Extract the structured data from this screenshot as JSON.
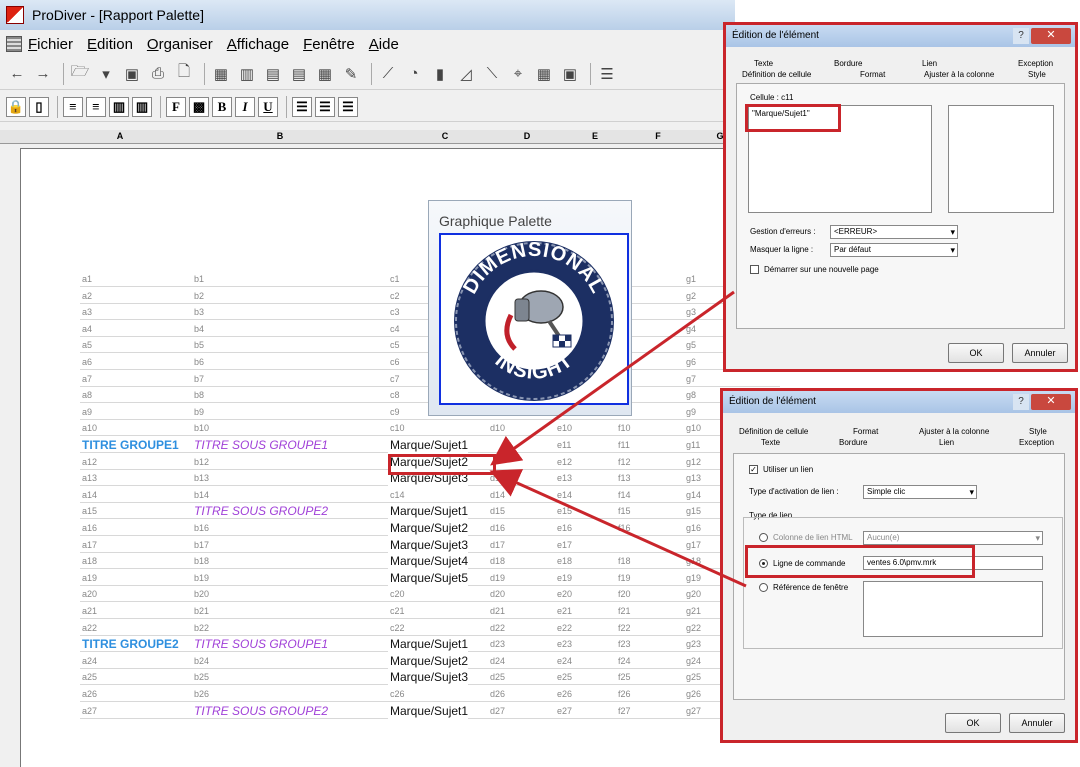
{
  "window": {
    "title": "ProDiver - [Rapport Palette]"
  },
  "menu": [
    "Fichier",
    "Edition",
    "Organiser",
    "Affichage",
    "Fenêtre",
    "Aide"
  ],
  "columns": [
    "A",
    "B",
    "C",
    "D",
    "E",
    "F",
    "G"
  ],
  "palette": {
    "title": "Graphique Palette",
    "logo_top": "DIMENSIONAL",
    "logo_bottom": "INSIGHT"
  },
  "rows": [
    [
      "a1",
      "b1",
      "c1",
      "",
      "",
      "",
      "g1"
    ],
    [
      "a2",
      "b2",
      "c2",
      "",
      "",
      "",
      "g2"
    ],
    [
      "a3",
      "b3",
      "c3",
      "",
      "",
      "",
      "g3"
    ],
    [
      "a4",
      "b4",
      "c4",
      "",
      "",
      "",
      "g4"
    ],
    [
      "a5",
      "b5",
      "c5",
      "",
      "",
      "",
      "g5"
    ],
    [
      "a6",
      "b6",
      "c6",
      "",
      "",
      "",
      "g6"
    ],
    [
      "a7",
      "b7",
      "c7",
      "",
      "",
      "",
      "g7"
    ],
    [
      "a8",
      "b8",
      "c8",
      "",
      "",
      "",
      "g8"
    ],
    [
      "a9",
      "b9",
      "c9",
      "d9",
      "e9",
      "f9",
      "g9"
    ],
    [
      "a10",
      "b10",
      "c10",
      "d10",
      "e10",
      "f10",
      "g10"
    ],
    [
      "TITRE GROUPE1",
      "TITRE SOUS GROUPE1",
      "Marque/Sujet1",
      "",
      "e11",
      "f11",
      "g11"
    ],
    [
      "a12",
      "b12",
      "Marque/Sujet2",
      "",
      "e12",
      "f12",
      "g12"
    ],
    [
      "a13",
      "b13",
      "Marque/Sujet3",
      "d13",
      "e13",
      "f13",
      "g13"
    ],
    [
      "a14",
      "b14",
      "c14",
      "d14",
      "e14",
      "f14",
      "g14"
    ],
    [
      "a15",
      "TITRE SOUS GROUPE2",
      "Marque/Sujet1",
      "d15",
      "e15",
      "f15",
      "g15"
    ],
    [
      "a16",
      "b16",
      "Marque/Sujet2",
      "d16",
      "e16",
      "f16",
      "g16"
    ],
    [
      "a17",
      "b17",
      "Marque/Sujet3",
      "d17",
      "e17",
      "",
      "g17"
    ],
    [
      "a18",
      "b18",
      "Marque/Sujet4",
      "d18",
      "e18",
      "f18",
      "g18"
    ],
    [
      "a19",
      "b19",
      "Marque/Sujet5",
      "d19",
      "e19",
      "f19",
      "g19"
    ],
    [
      "a20",
      "b20",
      "c20",
      "d20",
      "e20",
      "f20",
      "g20"
    ],
    [
      "a21",
      "b21",
      "c21",
      "d21",
      "e21",
      "f21",
      "g21"
    ],
    [
      "a22",
      "b22",
      "c22",
      "d22",
      "e22",
      "f22",
      "g22"
    ],
    [
      "TITRE GROUPE2",
      "TITRE SOUS GROUPE1",
      "Marque/Sujet1",
      "d23",
      "e23",
      "f23",
      "g23"
    ],
    [
      "a24",
      "b24",
      "Marque/Sujet2",
      "d24",
      "e24",
      "f24",
      "g24"
    ],
    [
      "a25",
      "b25",
      "Marque/Sujet3",
      "d25",
      "e25",
      "f25",
      "g25"
    ],
    [
      "a26",
      "b26",
      "c26",
      "d26",
      "e26",
      "f26",
      "g26"
    ],
    [
      "a27",
      "TITRE SOUS GROUPE2",
      "Marque/Sujet1",
      "d27",
      "e27",
      "f27",
      "g27"
    ]
  ],
  "dialog1": {
    "title": "Édition de l'élément",
    "tabs_row1": [
      "Texte",
      "Bordure",
      "Lien",
      "Exception"
    ],
    "tabs_row2": [
      "Définition de cellule",
      "Format",
      "Ajuster à la colonne",
      "Style"
    ],
    "cell_label": "Cellule : c11",
    "formula": "\"Marque/Sujet1\"",
    "error_label": "Gestion d'erreurs :",
    "error_value": "<ERREUR>",
    "hide_label": "Masquer la ligne :",
    "hide_value": "Par défaut",
    "newpage_label": "Démarrer sur une nouvelle page",
    "ok": "OK",
    "cancel": "Annuler"
  },
  "dialog2": {
    "title": "Édition de l'élément",
    "tabs_row1": [
      "Définition de cellule",
      "Format",
      "Ajuster à la colonne",
      "Style"
    ],
    "tabs_row2": [
      "Texte",
      "Bordure",
      "Lien",
      "Exception"
    ],
    "use_link": "Utiliser un lien",
    "activation_label": "Type d'activation de lien :",
    "activation_value": "Simple clic",
    "group_label": "Type de lien",
    "html_col_label": "Colonne de lien HTML",
    "html_col_value": "Aucun(e)",
    "cmd_label": "Ligne de commande",
    "cmd_value": "ventes 6.0\\pmv.mrk",
    "window_ref_label": "Référence de fenêtre",
    "ok": "OK",
    "cancel": "Annuler"
  },
  "colors": {
    "group_title": "#2e8fdf",
    "subgroup_title": "#a040d8",
    "highlight": "#c9252b"
  }
}
